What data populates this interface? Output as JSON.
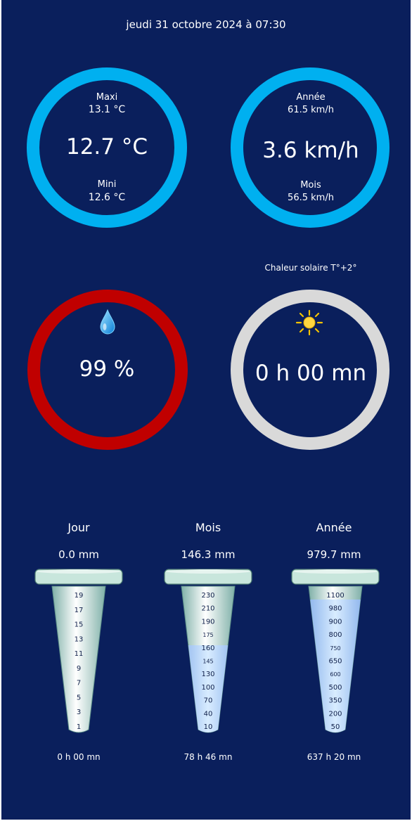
{
  "header": {
    "datetime": "jeudi 31 octobre 2024 à 07:30"
  },
  "temperature": {
    "max_label": "Maxi",
    "max_value": "13.1 °C",
    "current": "12.7 °C",
    "min_label": "Mini",
    "min_value": "12.6 °C",
    "ring_color": "#00b0f0"
  },
  "wind": {
    "year_label": "Année",
    "year_value": "61.5 km/h",
    "current": "3.6 km/h",
    "month_label": "Mois",
    "month_value": "56.5 km/h",
    "ring_color": "#00b0f0"
  },
  "humidity": {
    "value": "99 %",
    "icon": "water-drop-icon",
    "ring_color": "#c00000"
  },
  "sunshine": {
    "title": "Chaleur solaire T°+2°",
    "value": "0 h 00 mn",
    "icon": "sun-icon",
    "ring_color": "#d9d9d9"
  },
  "rain": {
    "day": {
      "label": "Jour",
      "amount": "0.0 mm",
      "duration": "0 h 00 mn",
      "fill_fraction": 0,
      "ticks": [
        "19",
        "17",
        "15",
        "13",
        "11",
        "9",
        "7",
        "5",
        "3",
        "1"
      ]
    },
    "month": {
      "label": "Mois",
      "amount": "146.3 mm",
      "duration": "78 h 46 mn",
      "fill_fraction": 0.6,
      "ticks": [
        "230",
        "210",
        "190",
        "175",
        "160",
        "145",
        "130",
        "100",
        "70",
        "40",
        "10"
      ]
    },
    "year": {
      "label": "Année",
      "amount": "979.7 mm",
      "duration": "637 h 20 mn",
      "fill_fraction": 0.91,
      "ticks": [
        "1100",
        "980",
        "900",
        "800",
        "750",
        "650",
        "600",
        "500",
        "350",
        "200",
        "50"
      ]
    }
  }
}
